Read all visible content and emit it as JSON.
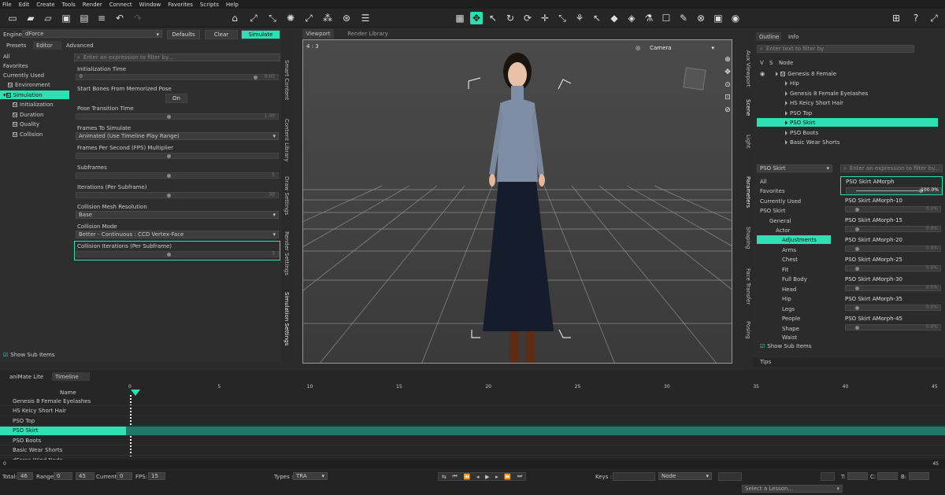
{
  "menu": [
    "File",
    "Edit",
    "Create",
    "Tools",
    "Render",
    "Connect",
    "Window",
    "Favorites",
    "Scripts",
    "Help"
  ],
  "engine": {
    "label": "Engine :",
    "value": "dForce",
    "defaults": "Defaults",
    "clear": "Clear",
    "simulate": "Simulate"
  },
  "lefttabs": [
    "Presets",
    "Editor",
    "Advanced"
  ],
  "tree": [
    "All",
    "Favorites",
    "Currently Used",
    "Environment",
    "Simulation",
    "Initialization",
    "Duration",
    "Quality",
    "Collision"
  ],
  "filter_placeholder": "Enter an expression to filter by...",
  "props": [
    {
      "label": "Initialization Time",
      "value": "0",
      "right": "0:00"
    },
    {
      "label": "Start Bones From Memorized Pose",
      "button": "On"
    },
    {
      "label": "Pose Transition Time",
      "value": "",
      "right": "1.00"
    },
    {
      "label": "Frames To Simulate",
      "select": "Animated (Use Timeline Play Range)"
    },
    {
      "label": "Frames Per Second (FPS) Multiplier",
      "value": "",
      "right": ""
    },
    {
      "label": "Subframes",
      "value": "",
      "right": "5"
    },
    {
      "label": "Iterations (Per Subframe)",
      "value": "",
      "right": "30"
    },
    {
      "label": "Collision Mesh Resolution",
      "select": "Base"
    },
    {
      "label": "Collision Mode",
      "select": "Better - Continuous : CCD Vertex-Face"
    },
    {
      "label": "Collision Iterations (Per Subframe)",
      "value": "",
      "right": "3"
    }
  ],
  "show_sub": "Show Sub Items",
  "vtabs_left": [
    "Smart Content",
    "Content Library",
    "Draw Settings",
    "Render Settings",
    "Simulation Settings"
  ],
  "vptabs": [
    "Viewport",
    "Render Library"
  ],
  "vp": {
    "aspect": "4 : 3",
    "camera": "Camera"
  },
  "outline": {
    "tabs": [
      "Outline",
      "Info"
    ],
    "placeholder": "Enter text to filter by",
    "cols": [
      "V",
      "S",
      "Node"
    ],
    "nodes": [
      "Genesis 8 Female",
      "Hip",
      "Genesis 8 Female Eyelashes",
      "HS Keicy Short Hair",
      "PSO Top",
      "PSO Skirt",
      "PSO Boots",
      "Basic Wear Shorts"
    ]
  },
  "vtabs_right": [
    "Aux Viewport",
    "Scene",
    "Light",
    "Parameters",
    "Shaping",
    "Face Transfer",
    "Posing"
  ],
  "params": {
    "node": "PSO Skirt",
    "tree": [
      "All",
      "Favorites",
      "Currently Used",
      "PSO Skirt",
      "General",
      "Actor",
      "Adjustments",
      "Arms",
      "Chest",
      "Fit",
      "Full Body",
      "Head",
      "Hip",
      "Legs",
      "People",
      "Shape",
      "Waist"
    ],
    "show_sub": "Show Sub Items",
    "morphs": [
      {
        "name": "PSO Skirt AMorph",
        "value": "100.0%"
      },
      {
        "name": "PSO Skirt AMorph-10",
        "value": "0.0%"
      },
      {
        "name": "PSO Skirt AMorph-15",
        "value": "0.0%"
      },
      {
        "name": "PSO Skirt AMorph-20",
        "value": "0.0%"
      },
      {
        "name": "PSO Skirt AMorph-25",
        "value": "0.0%"
      },
      {
        "name": "PSO Skirt AMorph-30",
        "value": "0.0%"
      },
      {
        "name": "PSO Skirt AMorph-35",
        "value": "0.0%"
      },
      {
        "name": "PSO Skirt AMorph-45",
        "value": "0.0%"
      }
    ],
    "morph_levels": [
      1,
      0,
      0,
      0,
      0,
      0,
      0,
      0
    ]
  },
  "tips": "Tips",
  "timeline": {
    "tabs": [
      "aniMate Lite",
      "Timeline"
    ],
    "name_col": "Name",
    "ticks": [
      "0",
      "5",
      "10",
      "15",
      "20",
      "25",
      "30",
      "35",
      "40",
      "45"
    ],
    "rows": [
      "Genesis 8 Female Eyelashes",
      "HS Keicy Short Hair",
      "PSO Top",
      "PSO Skirt",
      "PSO Boots",
      "Basic Wear Shorts",
      "dForce Wind Node"
    ],
    "scroll_start": "0",
    "scroll_end": "45"
  },
  "bottom": {
    "total_label": "Total:",
    "total": "46",
    "range_label": "Range:",
    "range_a": "0",
    "range_b": "45",
    "current_label": "Current:",
    "current": "0",
    "fps_label": "FPS:",
    "fps": "15",
    "types_label": "Types :",
    "types": "TRA",
    "keys_label": "Keys :",
    "node": "Node",
    "t": "T:",
    "c": "C:",
    "b": "B:",
    "lesson": "Select a Lesson..."
  }
}
